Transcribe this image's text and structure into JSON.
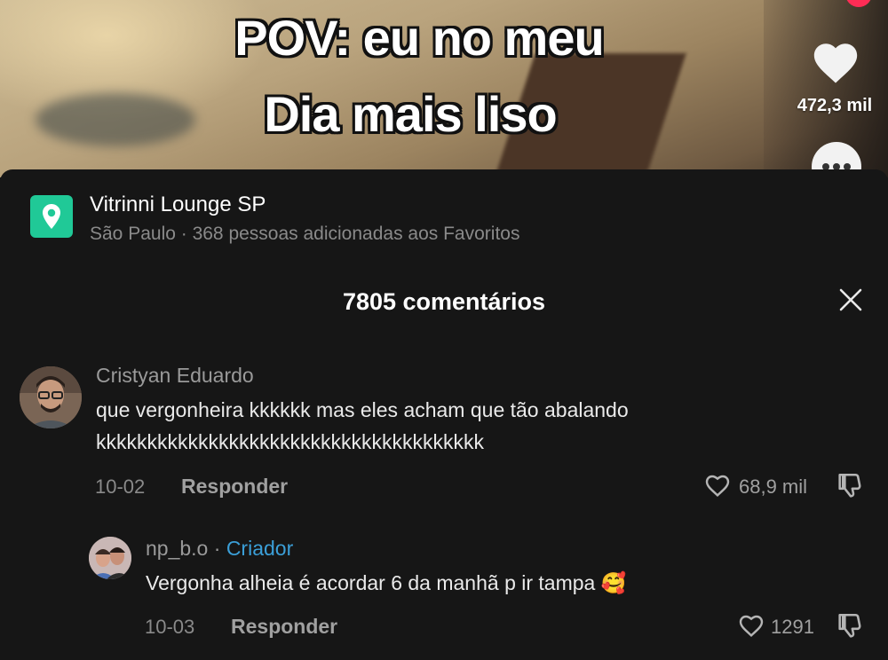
{
  "video": {
    "caption_line1": "POV: eu no meu",
    "caption_line2": "Dia mais liso",
    "like_count": "472,3 mil",
    "like_icon": "heart-icon",
    "more_icon": "more-dots-icon"
  },
  "place": {
    "name": "Vitrinni Lounge SP",
    "subtitle": "São Paulo · 368 pessoas adicionadas aos Favoritos",
    "icon": "location-pin-icon",
    "accent": "#20c997"
  },
  "comments_header": {
    "title": "7805 comentários",
    "close_icon": "close-icon"
  },
  "comments": [
    {
      "author": "Cristyan Eduardo",
      "text_line1": "que vergonheira kkkkkk mas eles acham que tão abalando",
      "text_line2": "kkkkkkkkkkkkkkkkkkkkkkkkkkkkkkkkkkkkkk",
      "date": "10-02",
      "reply_label": "Responder",
      "likes": "68,9 mil"
    },
    {
      "author": "np_b.o",
      "badge_sep": " · ",
      "badge": "Criador",
      "text": "Vergonha alheia é acordar 6 da manhã p ir tampa 🥰",
      "date": "10-03",
      "reply_label": "Responder",
      "likes": "1291"
    }
  ],
  "colors": {
    "background": "#161616",
    "creator_badge": "#3b9fd8",
    "brand_red": "#fe2c55"
  }
}
